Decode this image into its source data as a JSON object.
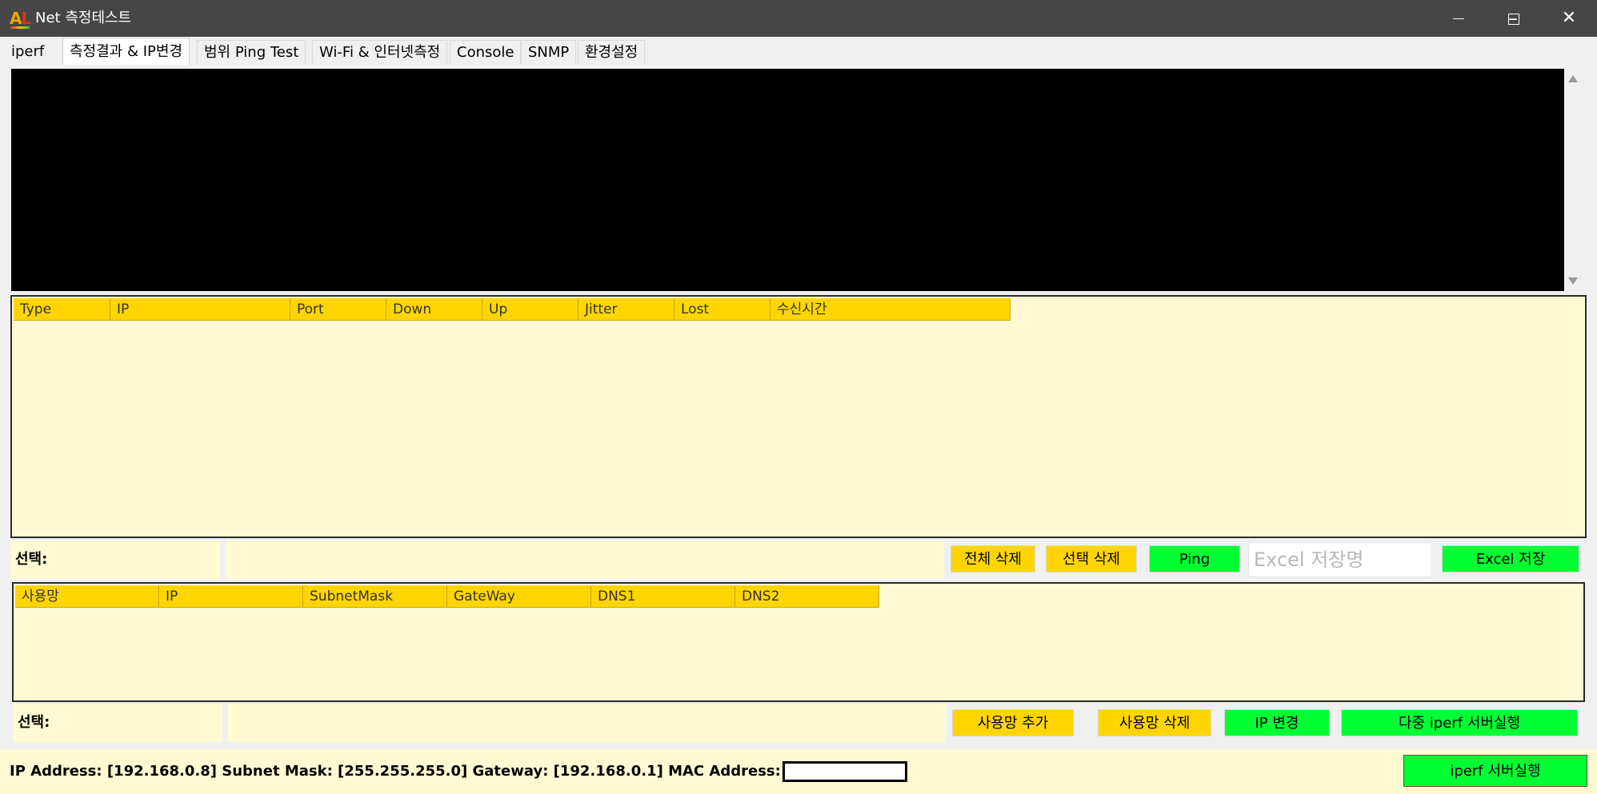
{
  "window": {
    "title": "Net 측정테스트",
    "logo_a": "A",
    "logo_l": "L",
    "minimize": "–",
    "maximize": "☐",
    "close": "✕"
  },
  "tabs": [
    {
      "label": "iperf",
      "active": false
    },
    {
      "label": "측정결과 & IP변경",
      "active": true
    },
    {
      "label": "범위 Ping Test",
      "active": false
    },
    {
      "label": "Wi-Fi & 인터넷측정",
      "active": false
    },
    {
      "label": "Console",
      "active": false
    },
    {
      "label": "SNMP",
      "active": false
    },
    {
      "label": "환경설정",
      "active": false
    }
  ],
  "results_table": {
    "columns": [
      "Type",
      "IP",
      "Port",
      "Down",
      "Up",
      "Jitter",
      "Lost",
      "수신시간"
    ],
    "rows": []
  },
  "results_actions": {
    "select_label": "선택:",
    "delete_all": "전체 삭제",
    "delete_selected": "선택 삭제",
    "ping": "Ping",
    "excel_name_placeholder": "Excel 저장명",
    "excel_save": "Excel 저장"
  },
  "profiles_table": {
    "columns": [
      "사용망",
      "IP",
      "SubnetMask",
      "GateWay",
      "DNS1",
      "DNS2"
    ],
    "rows": []
  },
  "profiles_actions": {
    "select_label": "선택:",
    "add_profile": "사용망 추가",
    "delete_profile": "사용망 삭제",
    "change_ip": "IP 변경",
    "multi_iperf_server": "다중 iperf 서버실행"
  },
  "status": {
    "text": "IP Address: [192.168.0.8] Subnet Mask: [255.255.255.0] Gateway: [192.168.0.1] MAC Address:",
    "iperf_server": "iperf 서버실행"
  },
  "colors": {
    "header_yellow": "#ffd500",
    "panel_bg": "#fffad1",
    "action_green": "#00ff33",
    "titlebar": "#464646"
  }
}
